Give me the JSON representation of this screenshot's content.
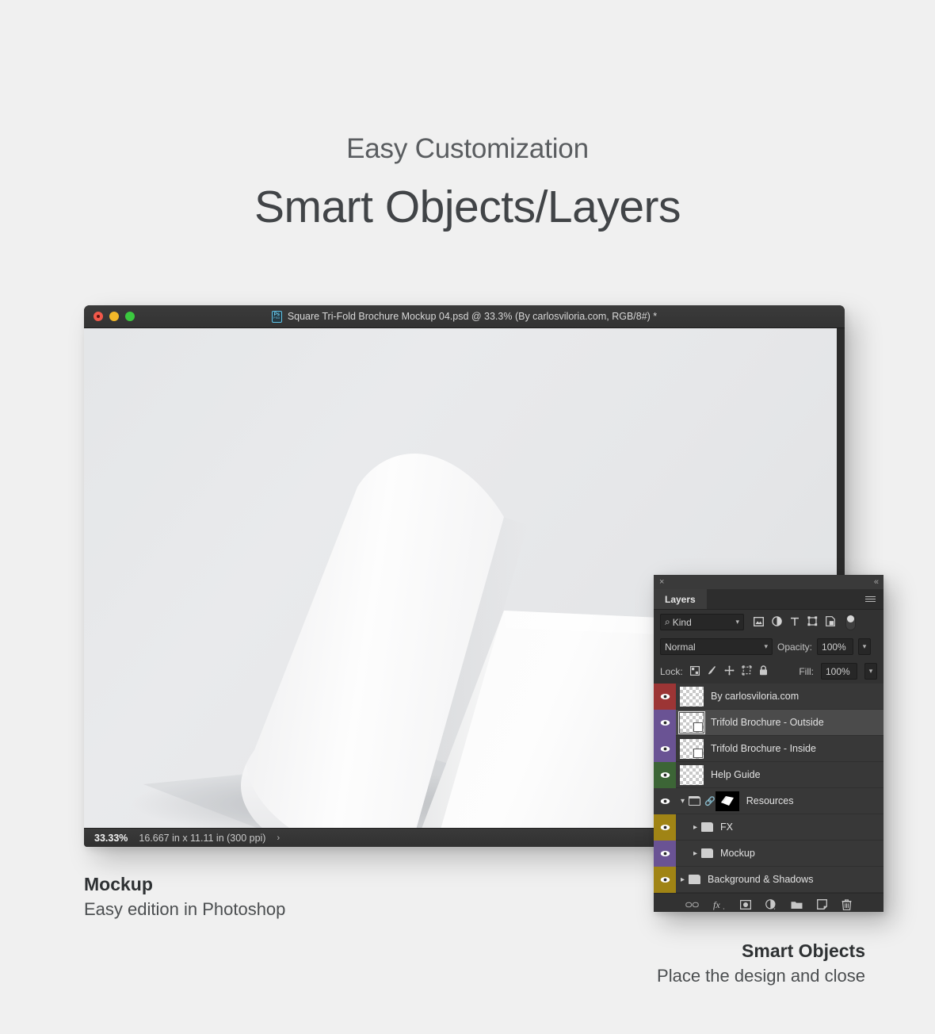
{
  "headings": {
    "subtitle": "Easy Customization",
    "title": "Smart Objects/Layers"
  },
  "photoshop_window": {
    "titlebar": {
      "document_title": "Square Tri-Fold Brochure Mockup 04.psd @ 33.3% (By carlosviloria.com, RGB/8#) *",
      "file_icon_label": "Ps",
      "file_icon_sub": "PSD",
      "traffic_lights": [
        "close-button",
        "minimize-button",
        "zoom-button"
      ]
    },
    "statusbar": {
      "zoom_level": "33.33%",
      "document_size": "16.667 in x 11.11 in (300 ppi)",
      "expand_arrow": "›"
    }
  },
  "layers_panel": {
    "close_icon": "×",
    "collapse_icon": "«",
    "tab_label": "Layers",
    "menu_icon": "panel-menu-icon",
    "filter": {
      "kind_label": "Kind",
      "search_icon": "⌕",
      "chevron": "⌄",
      "icon_filters": [
        "pixel-layer-filter-icon",
        "adjustment-layer-filter-icon",
        "type-layer-filter-icon",
        "shape-layer-filter-icon",
        "smart-object-filter-icon"
      ],
      "toggle": "filter-enable-toggle"
    },
    "blend": {
      "mode": "Normal",
      "opacity_label": "Opacity:",
      "opacity_value": "100%"
    },
    "lock": {
      "label": "Lock:",
      "icons": [
        "lock-transparent-pixels-icon",
        "lock-image-pixels-icon",
        "lock-position-icon",
        "lock-artboard-nesting-icon",
        "lock-all-icon"
      ],
      "fill_label": "Fill:",
      "fill_value": "100%"
    },
    "layers": [
      {
        "name": "By carlosviloria.com",
        "color": "#9c3535",
        "visible": true,
        "type": "raster",
        "selected": false,
        "indent": 0
      },
      {
        "name": "Trifold Brochure - Outside",
        "color": "#6a5394",
        "visible": true,
        "type": "smart-object",
        "selected": true,
        "indent": 0
      },
      {
        "name": "Trifold Brochure - Inside",
        "color": "#6a5394",
        "visible": true,
        "type": "smart-object",
        "selected": false,
        "indent": 0
      },
      {
        "name": "Help Guide",
        "color": "#3c6536",
        "visible": true,
        "type": "raster",
        "selected": false,
        "indent": 0
      },
      {
        "name": "Resources",
        "color": "#383838",
        "visible": true,
        "type": "group-open-masked",
        "selected": false,
        "indent": 0
      },
      {
        "name": "FX",
        "color": "#a08415",
        "visible": true,
        "type": "group",
        "selected": false,
        "indent": 1
      },
      {
        "name": "Mockup",
        "color": "#6a5394",
        "visible": true,
        "type": "group",
        "selected": false,
        "indent": 1
      },
      {
        "name": "Background & Shadows",
        "color": "#a08415",
        "visible": true,
        "type": "group",
        "selected": false,
        "indent": 0
      }
    ],
    "footer_buttons": [
      "link-layers-icon",
      "layer-style-fx-icon",
      "add-layer-mask-icon",
      "new-adjustment-layer-icon",
      "new-group-icon",
      "new-layer-icon",
      "delete-layer-icon"
    ]
  },
  "captions": {
    "mockup": {
      "title": "Mockup",
      "subtitle": "Easy edition in Photoshop"
    },
    "smart_objects": {
      "title": "Smart Objects",
      "subtitle": "Place the design and close"
    }
  },
  "colors": {
    "page_background": "#f0f0f0",
    "heading": "#414447",
    "subheading": "#5a5d60",
    "panel_background": "#323232",
    "layer_row": "#383838",
    "layer_row_selected": "#4b4b4b"
  }
}
